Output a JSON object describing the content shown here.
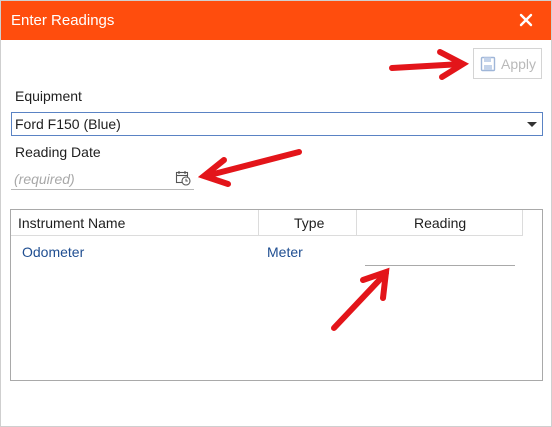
{
  "dialog": {
    "title": "Enter Readings"
  },
  "toolbar": {
    "apply_label": "Apply"
  },
  "form": {
    "equipment_label": "Equipment",
    "equipment_value": "Ford F150 (Blue)",
    "reading_date_label": "Reading Date",
    "reading_date_placeholder": "(required)"
  },
  "grid": {
    "columns": [
      "Instrument Name",
      "Type",
      "Reading"
    ],
    "rows": [
      {
        "instrument": "Odometer",
        "type": "Meter",
        "reading": ""
      }
    ]
  },
  "colors": {
    "titlebar": "#ff4d0d",
    "link_text": "#1f4e91",
    "annotation_arrow": "#e3151a"
  },
  "icons": [
    "close-icon",
    "save-icon",
    "calendar-clock-icon",
    "dropdown-caret-icon"
  ]
}
